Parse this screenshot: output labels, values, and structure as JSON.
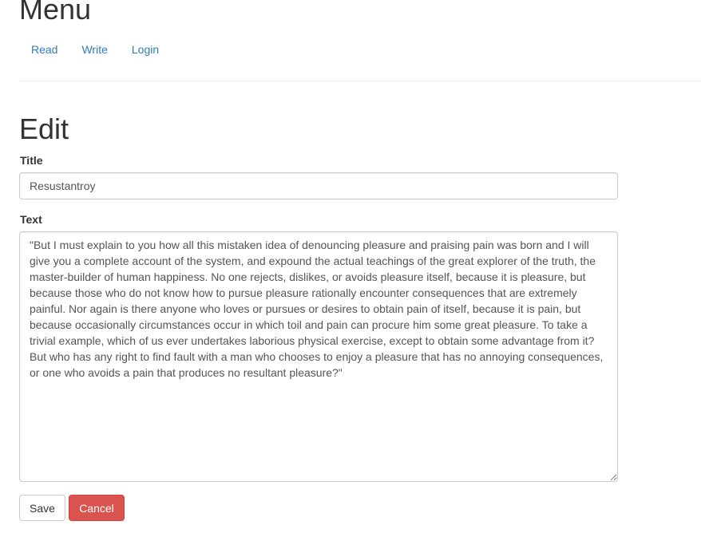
{
  "header": {
    "title": "Menu"
  },
  "nav": {
    "items": [
      {
        "label": "Read"
      },
      {
        "label": "Write"
      },
      {
        "label": "Login"
      }
    ]
  },
  "form": {
    "heading": "Edit",
    "title_label": "Title",
    "title_value": "Resustantroy",
    "text_label": "Text",
    "text_value": "\"But I must explain to you how all this mistaken idea of denouncing pleasure and praising pain was born and I will give you a complete account of the system, and expound the actual teachings of the great explorer of the truth, the master-builder of human happiness. No one rejects, dislikes, or avoids pleasure itself, because it is pleasure, but because those who do not know how to pursue pleasure rationally encounter consequences that are extremely painful. Nor again is there anyone who loves or pursues or desires to obtain pain of itself, because it is pain, but because occasionally circumstances occur in which toil and pain can procure him some great pleasure. To take a trivial example, which of us ever undertakes laborious physical exercise, except to obtain some advantage from it? But who has any right to find fault with a man who chooses to enjoy a pleasure that has no annoying consequences, or one who avoids a pain that produces no resultant pleasure?\"",
    "save_label": "Save",
    "cancel_label": "Cancel"
  },
  "colors": {
    "link": "#337ab7",
    "danger": "#d9534f",
    "text": "#333333",
    "border": "#cccccc"
  }
}
